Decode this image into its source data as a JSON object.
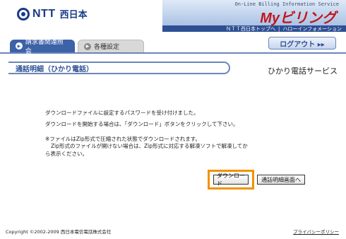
{
  "header": {
    "logo_text": "NTT",
    "logo_jp": "西日本",
    "banner_subtitle": "On-Line Billing Information Service",
    "banner_title": "Myビリング",
    "links": [
      "ＮＴＴ西日本トップへ",
      "|",
      "ハローインフォメーション"
    ]
  },
  "nav": {
    "tabs": [
      {
        "label": "請求書関連照会",
        "active": true
      },
      {
        "label": "各種設定",
        "active": false
      }
    ],
    "logout_label": "ログアウト ▸▸"
  },
  "section": {
    "title": "通話明細（ひかり電話）",
    "service": "ひかり電話サービス"
  },
  "messages": {
    "line1": "ダウンロードファイルに設定するパスワードを受け付けました。",
    "line2": "ダウンロードを開始する場合は、「ダウンロード」ボタンをクリックして下さい。",
    "line3a": "※ファイルはZip形式で圧縮された状態でダウンロードされます。",
    "line3b": "Zip形式のファイルが開けない場合は、Zip形式に対応する解凍ソフトで解凍してか",
    "line3c": "ら表示ください。"
  },
  "buttons": {
    "download": "ダウンロード",
    "back": "通話明細画面へ"
  },
  "footer": {
    "copyright": "Copyright ©2002-2009 西日本電信電話株式会社",
    "privacy": "プライバシーポリシー"
  },
  "colors": {
    "brand_blue": "#2d4f94",
    "brand_red": "#c0171d",
    "highlight_orange": "#f39200"
  }
}
